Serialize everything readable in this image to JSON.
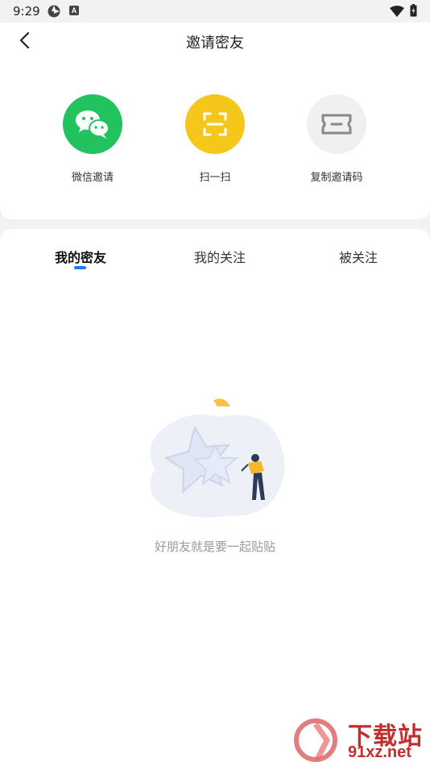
{
  "status_bar": {
    "time": "9:29",
    "icon_b_letter": "A"
  },
  "header": {
    "title": "邀请密友"
  },
  "share_options": [
    {
      "label": "微信邀请",
      "color": "#22c35e",
      "icon": "wechat-icon"
    },
    {
      "label": "扫一扫",
      "color": "#f5c71a",
      "icon": "scan-icon"
    },
    {
      "label": "复制邀请码",
      "color": "#f0f0f2",
      "icon": "ticket-icon"
    }
  ],
  "tabs": [
    {
      "label": "我的密友",
      "active": true
    },
    {
      "label": "我的关注",
      "active": false
    },
    {
      "label": "被关注",
      "active": false
    }
  ],
  "empty_state": {
    "text": "好朋友就是要一起贴贴"
  },
  "watermark": {
    "text": "下载站",
    "url": "91xz.net"
  },
  "colors": {
    "accent": "#1e7bf5",
    "background": "#f2f2f4"
  }
}
